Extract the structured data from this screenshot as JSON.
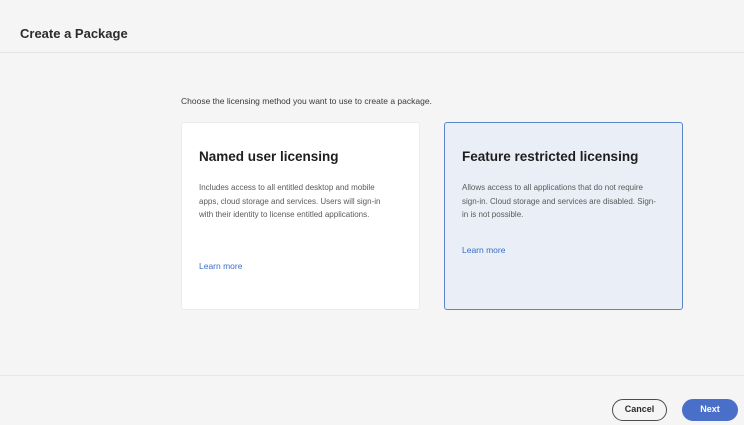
{
  "header": {
    "title": "Create a Package"
  },
  "main": {
    "instruction": "Choose the licensing method you want to use to create a package.",
    "cards": [
      {
        "title": "Named user licensing",
        "description": "Includes access to all entitled desktop and mobile apps, cloud storage and services. Users will sign-in with their identity to license entitled applications.",
        "link_label": "Learn more",
        "selected": false
      },
      {
        "title": "Feature restricted licensing",
        "description": "Allows access to all applications that do not require sign-in. Cloud storage and services are disabled. Sign-in is not possible.",
        "link_label": "Learn more",
        "selected": true
      }
    ]
  },
  "footer": {
    "cancel_label": "Cancel",
    "next_label": "Next"
  },
  "colors": {
    "accent": "#4a6fc9",
    "selected_card_bg": "#e9eef7",
    "selected_card_border": "#5c86c9",
    "link": "#3b6ec5"
  }
}
